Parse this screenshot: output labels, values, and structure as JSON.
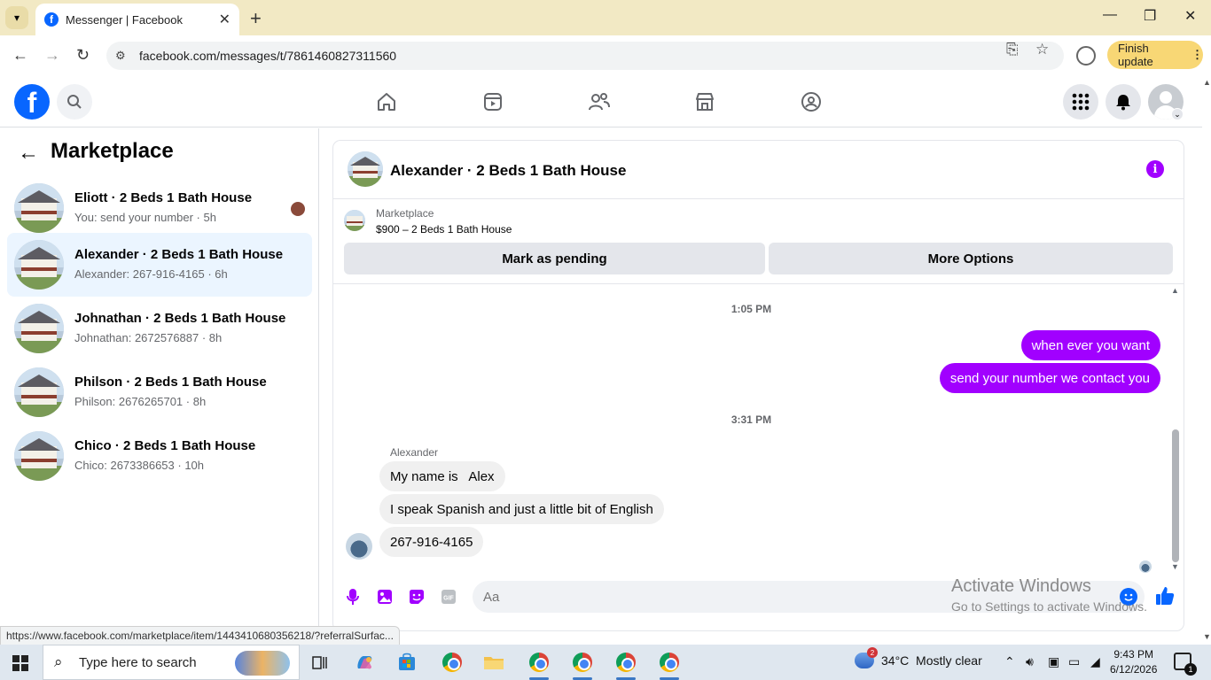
{
  "browser": {
    "tab_title": "Messenger | Facebook",
    "url": "facebook.com/messages/t/7861460827311560",
    "finish_update": "Finish update",
    "status_url": "https://www.facebook.com/marketplace/item/1443410680356218/?referralSurfac..."
  },
  "sidebar": {
    "title": "Marketplace",
    "conversations": [
      {
        "name": "Eliott · 2 Beds 1 Bath House",
        "preview": "You: send your number · 5h",
        "active": false
      },
      {
        "name": "Alexander · 2 Beds 1 Bath House",
        "preview": "Alexander: 267-916-4165 · 6h",
        "active": true
      },
      {
        "name": "Johnathan · 2 Beds 1 Bath House",
        "preview": "Johnathan: 2672576887 · 8h",
        "active": false
      },
      {
        "name": "Philson · 2 Beds 1 Bath House",
        "preview": "Philson: 2676265701 · 8h",
        "active": false
      },
      {
        "name": "Chico · 2 Beds 1 Bath House",
        "preview": "Chico: 2673386653 · 10h",
        "active": false
      }
    ]
  },
  "chat": {
    "title": "Alexander · 2 Beds 1 Bath House",
    "listing": {
      "label": "Marketplace",
      "price_line": "$900 – 2 Beds 1 Bath House",
      "mark_pending": "Mark as pending",
      "more_options": "More Options"
    },
    "timestamps": [
      "1:05 PM",
      "3:31 PM"
    ],
    "outgoing": [
      "when ever you want",
      "send your number we contact you"
    ],
    "sender": "Alexander",
    "incoming": [
      "My name is   Alex",
      "I speak Spanish and just a little bit of English",
      "267-916-4165"
    ],
    "input_placeholder": "Aa"
  },
  "watermark": {
    "line1": "Activate Windows",
    "line2": "Go to Settings to activate Windows."
  },
  "taskbar": {
    "search_placeholder": "Type here to search",
    "weather": "34°C  Mostly clear",
    "weather_badge": "2",
    "time": "9:43 PM",
    "date": "6/12/2026",
    "notifications": "1"
  },
  "colors": {
    "messenger_purple": "#a100ff",
    "facebook_blue": "#0866ff",
    "active_conv_bg": "#ebf5ff",
    "tabstrip_bg": "#f2e9c4",
    "finish_update_bg": "#f8d775"
  }
}
